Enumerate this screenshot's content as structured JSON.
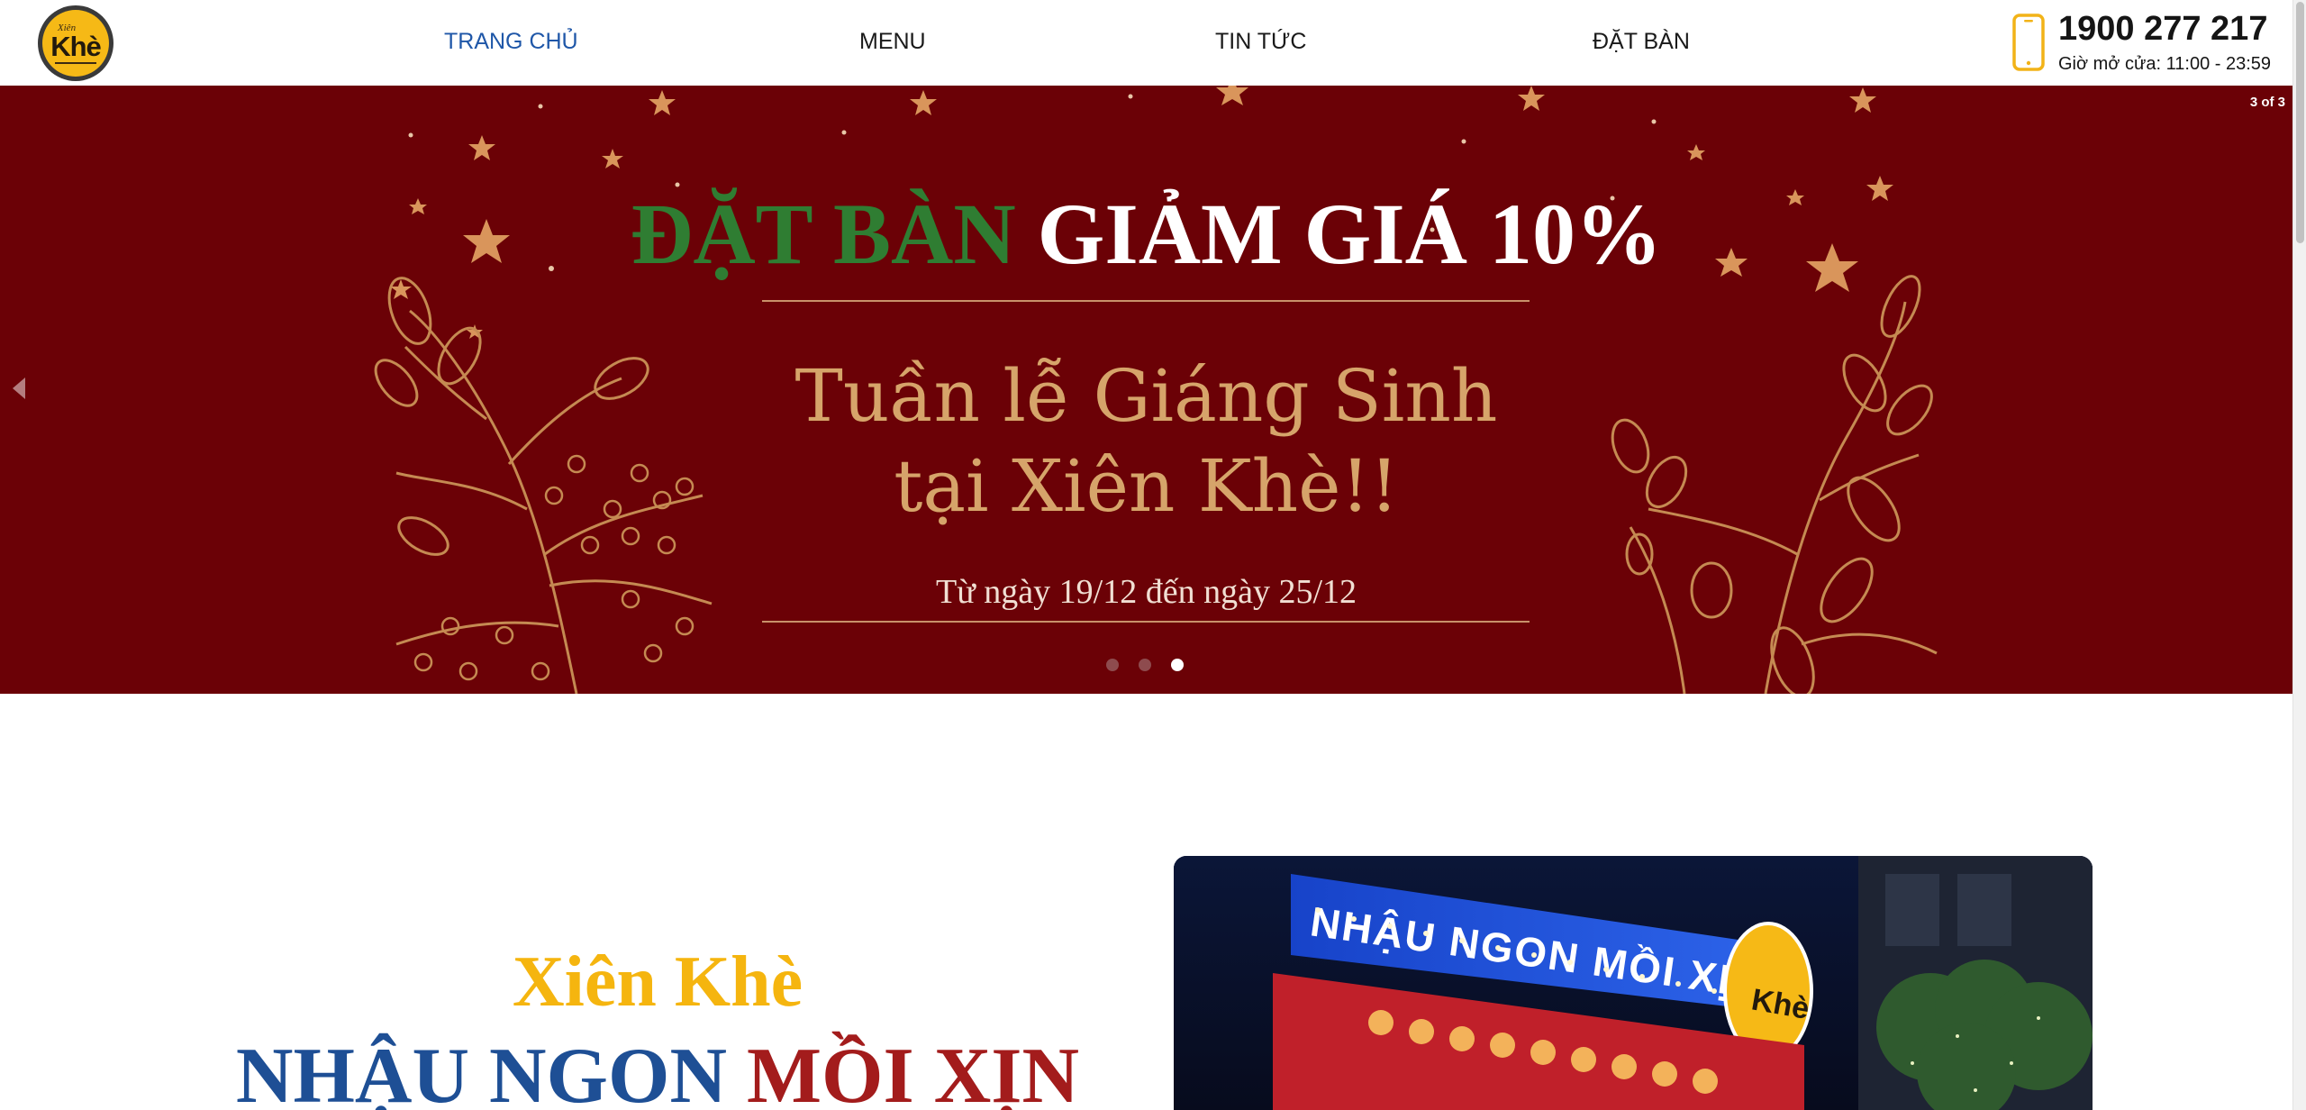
{
  "header": {
    "logo": {
      "small_text": "Xiên",
      "big_text": "Khè"
    },
    "nav": [
      {
        "label": "TRANG CHỦ",
        "active": true
      },
      {
        "label": "MENU",
        "active": false
      },
      {
        "label": "TIN TỨC",
        "active": false
      },
      {
        "label": "ĐẶT BÀN",
        "active": false
      }
    ],
    "phone_icon": "smartphone-icon",
    "phone": "1900 277 217",
    "hours": "Giờ mở cửa: 11:00 - 23:59"
  },
  "slider": {
    "counter": "3 of 3",
    "title_highlight": "ĐẶT BÀN",
    "title_rest": "GIẢM GIÁ 10%",
    "subtitle_line1": "Tuần lễ Giáng Sinh",
    "subtitle_line2": "tại Xiên Khè!!",
    "date_range": "Từ ngày 19/12 đến ngày 25/12",
    "slides_total": 3,
    "active_slide": 3
  },
  "about": {
    "brand": "Xiên Khè",
    "slogan_part1": "NHẬU NGON",
    "slogan_part2": "MỒI XỊN",
    "photo_sign": "NHẬU NGON MỒI XỊN"
  },
  "colors": {
    "nav_active": "#1f57a8",
    "hero_bg": "#6b0106",
    "gold": "#d6a46a",
    "green": "#2f7d32",
    "brand_yellow": "#f5b50f",
    "slogan_blue": "#1e4f95",
    "slogan_red": "#a31c1c"
  }
}
